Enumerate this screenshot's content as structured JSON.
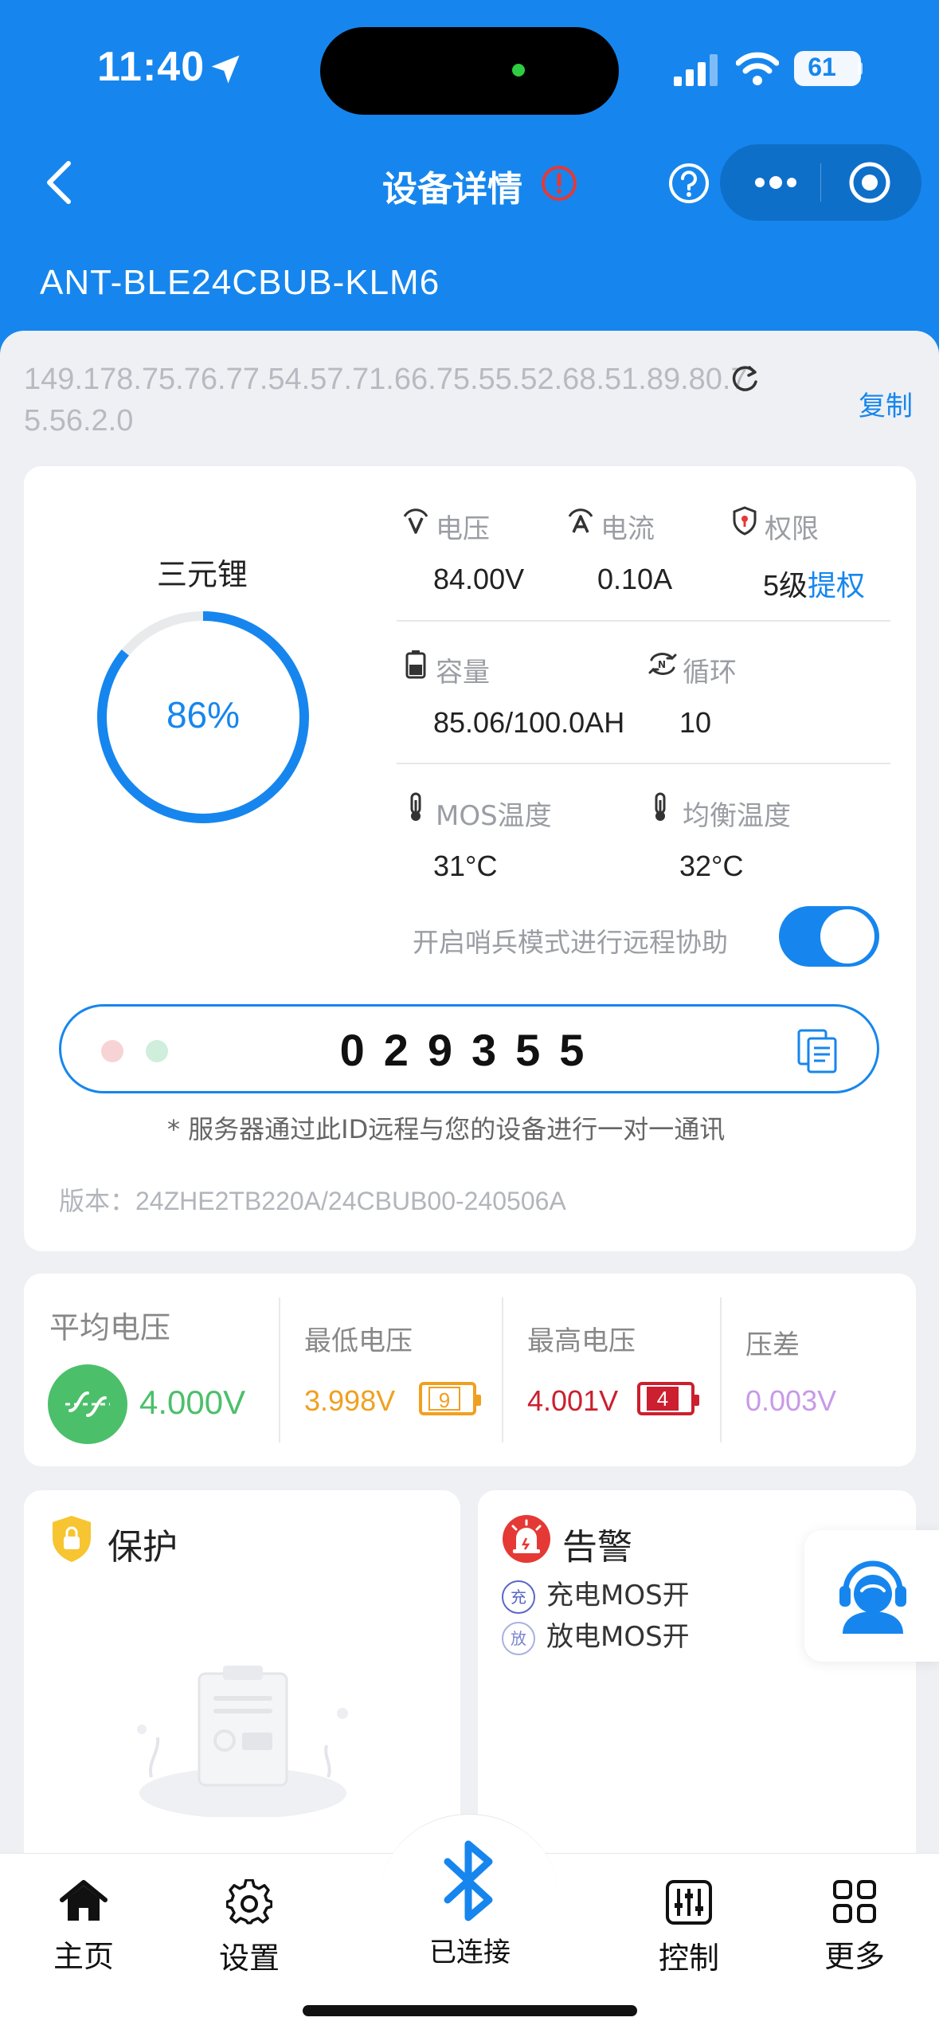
{
  "status_bar": {
    "time": "11:40",
    "battery": "61"
  },
  "nav": {
    "title": "设备详情"
  },
  "device": {
    "name": "ANT-BLE24CBUB-KLM6",
    "address": "149.178.75.76.77.54.57.71.66.75.55.52.68.51.89.80.75.56.2.0",
    "copy_label": "复制"
  },
  "battery_card": {
    "chemistry": "三元锂",
    "soc": "86%",
    "soc_fraction": 0.86,
    "voltage_label": "电压",
    "voltage": "84.00V",
    "current_label": "电流",
    "current": "0.10A",
    "permission_label": "权限",
    "permission_level": "5级",
    "permission_action": "提权",
    "capacity_label": "容量",
    "capacity": "85.06/100.0AH",
    "cycle_label": "循环",
    "cycle": "10",
    "mos_temp_label": "MOS温度",
    "mos_temp": "31°C",
    "balance_temp_label": "均衡温度",
    "balance_temp": "32°C",
    "sentinel_label": "开启哨兵模式进行远程协助",
    "sentinel_on": true,
    "remote_id": "029355",
    "remote_note": "* 服务器通过此ID远程与您的设备进行一对一通讯",
    "version": "版本：24ZHE2TB220A/24CBUB00-240506A"
  },
  "voltage_card": {
    "avg_label": "平均电压",
    "avg_value": "4.000V",
    "min_label": "最低电压",
    "min_value": "3.998V",
    "min_cell": "9",
    "max_label": "最高电压",
    "max_value": "4.001V",
    "max_cell": "4",
    "diff_label": "压差",
    "diff_value": "0.003V",
    "colors": {
      "avg": "#4cbf6b",
      "min": "#f0a020",
      "max": "#cc1f2f",
      "diff": "#c79ae8"
    }
  },
  "protection": {
    "title": "保护"
  },
  "alarm": {
    "title": "告警",
    "items": [
      {
        "badge": "充",
        "text": "充电MOS开"
      },
      {
        "badge": "放",
        "text": "放电MOS开"
      }
    ]
  },
  "tabs": {
    "home": "主页",
    "settings": "设置",
    "bluetooth": "已连接",
    "control": "控制",
    "more": "更多"
  },
  "accent": "#1686ee"
}
